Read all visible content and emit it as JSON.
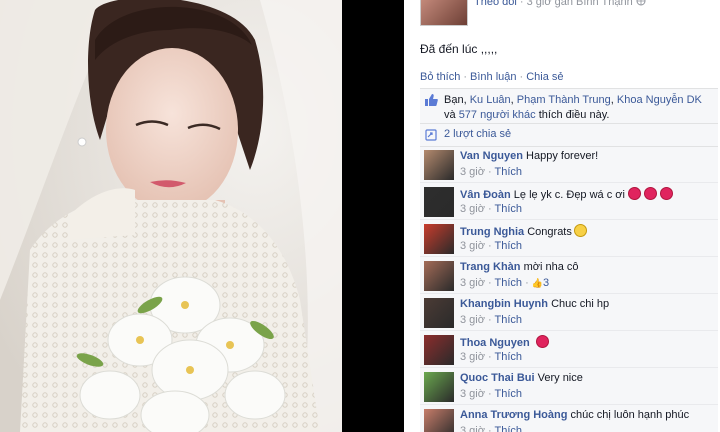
{
  "post": {
    "follow_label": "Theo dõi",
    "time_location": "· 3 giờ gần Bình Thạnh",
    "text": "Đã đến lúc ,,,,,",
    "actions": {
      "like": "Bỏ thích",
      "comment": "Bình luận",
      "share": "Chia sẻ"
    }
  },
  "likes": {
    "prefix": "Bạn, ",
    "names": [
      "Ku Luân",
      "Phạm Thành Trung",
      "Khoa Nguyễn DK"
    ],
    "and": "và",
    "others": "577 người khác",
    "suffix": "thích điều này."
  },
  "shares": {
    "label": "2 lượt chia sẻ"
  },
  "comments": [
    {
      "name": "Van Nguyen",
      "text": "Happy forever!",
      "time": "3 giờ",
      "like": "Thích",
      "avatar_color": "#b48a6e"
    },
    {
      "name": "Vân Đoàn",
      "text": "Lẹ lẹ yk c. Đẹp wá c ơi",
      "time": "3 giờ",
      "like": "Thích",
      "avatar_color": "#2e2e2e",
      "hearts": 3
    },
    {
      "name": "Trung Nghia",
      "text": "Congrats",
      "time": "3 giờ",
      "like": "Thích",
      "avatar_color": "#c83c2c",
      "smile": true
    },
    {
      "name": "Trang Khàn",
      "text": "mời nha cô",
      "time": "3 giờ",
      "like": "Thích",
      "avatar_color": "#a36b57",
      "like_count": "3"
    },
    {
      "name": "Khangbin Huynh",
      "text": "Chuc chi hp",
      "time": "3 giờ",
      "like": "Thích",
      "avatar_color": "#4b3b35"
    },
    {
      "name": "Thoa Nguyen",
      "text": "",
      "time": "3 giờ",
      "like": "Thích",
      "avatar_color": "#8c2d2d",
      "hearts": 1
    },
    {
      "name": "Quoc Thai Bui",
      "text": "Very nice",
      "time": "3 giờ",
      "like": "Thích",
      "avatar_color": "#6aa84f"
    },
    {
      "name": "Anna Trương Hoàng",
      "text": "chúc chị luôn hạnh phúc",
      "time": "3 giờ",
      "like": "Thích",
      "avatar_color": "#c77d6a"
    }
  ]
}
